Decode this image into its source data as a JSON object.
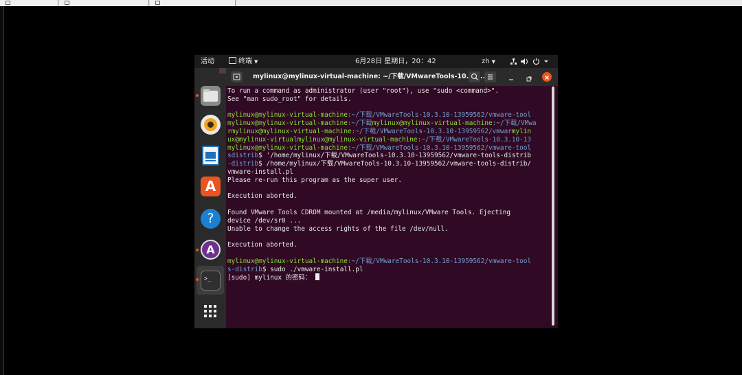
{
  "topbar": {
    "activities": "活动",
    "app_menu": "终端",
    "clock": "6月28日 星期日，20：42",
    "input_method": "zh"
  },
  "terminal": {
    "title": "mylinux@mylinux-virtual-machine: ~/下载/VMwareTools-10.3.1...",
    "lines": {
      "l1": "To run a command as administrator (user \"root\"), use \"sudo <command>\".",
      "l2": "See \"man sudo_root\" for details.",
      "p3a": "mylinux@mylinux-virtual-machine",
      "p3b": ":~/下载/VMwareTools-10.3.10-13959562/vmware-tool",
      "p4a": "mylinux@mylinux-virtual-machine",
      "p4b": ":~/下载",
      "p4c": "mylinux@mylinux-virtual-machine",
      "p4d": ":~/下载/VMwa",
      "p5a": "rmylinux@mylinux-virtual-machine",
      "p5b": ":~/下载/VMwareTools-10.3.10-13959562/vmwar",
      "p5c": "mylin",
      "p6a": "ux@mylinux-virtualmylinux@mylinux-virtual-machine",
      "p6b": ":~/下载/VMwareTools-10.3.10-13",
      "p7a": "mylinux@mylinux-virtual-machine",
      "p7b": ":~/下载/VMwareTools-10.3.10-13959562/vmware-tool",
      "p8a": "sdistrib",
      "p8b": "$ '/home/mylinux/下载/VMwareTools-10.3.10-13959562/vmware-tools-distrib",
      "p9a": "-distrib",
      "p9b": "$ /home/mylinux/下载/VMwareTools-10.3.10-13959562/vmware-tools-distrib/",
      "l10": "vmware-install.pl",
      "l11": "Please re-run this program as the super user.",
      "l13": "Execution aborted.",
      "l15": "Found VMware Tools CDROM mounted at /media/mylinux/VMware Tools. Ejecting",
      "l16": "device /dev/sr0 ...",
      "l17": "Unable to change the access rights of the file /dev/null.",
      "l19": "Execution aborted.",
      "p21a": "mylinux@mylinux-virtual-machine",
      "p21b": ":~/下载/VMwareTools-10.3.10-13959562/vmware-tool",
      "p22a": "s-distrib",
      "p22b": "$ sudo ./vmware-install.pl",
      "l23": "[sudo] mylinux 的密码： "
    }
  },
  "icons": {
    "dock": [
      "files-icon",
      "rhythmbox-icon",
      "writer-icon",
      "software-icon",
      "help-icon",
      "updater-icon",
      "terminal-icon",
      "show-apps-icon"
    ]
  },
  "colors": {
    "terminal_bg": "#300a24",
    "prompt_user": "#8ae234",
    "prompt_path": "#729fcf",
    "close": "#e95420"
  }
}
